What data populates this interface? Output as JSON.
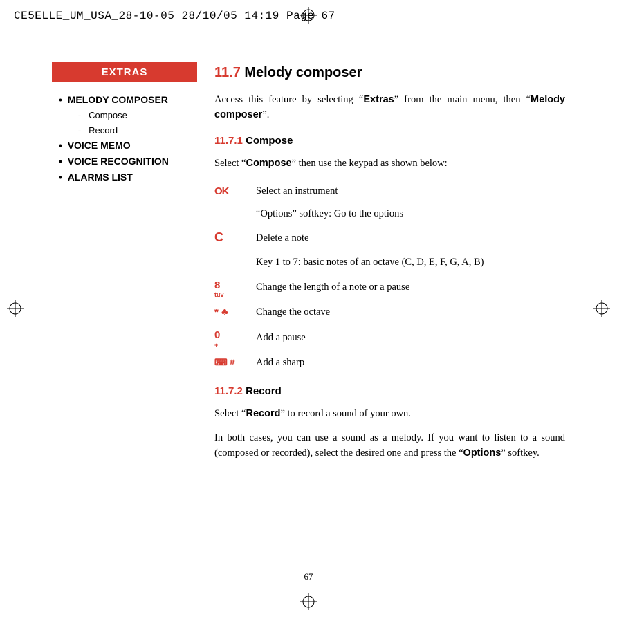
{
  "header": "CE5ELLE_UM_USA_28-10-05  28/10/05  14:19  Page 67",
  "sidebar": {
    "title": "EXTRAS",
    "items": [
      {
        "label": "MELODY COMPOSER",
        "sub": [
          "Compose",
          "Record"
        ]
      },
      {
        "label": "VOICE MEMO"
      },
      {
        "label": "VOICE RECOGNITION"
      },
      {
        "label": "ALARMS LIST"
      }
    ]
  },
  "section": {
    "num": "11.7",
    "title": "Melody composer",
    "intro_pre": "Access this feature by selecting “",
    "intro_b1": "Extras",
    "intro_mid": "” from the main menu, then “",
    "intro_b2": "Melody composer",
    "intro_post": "”."
  },
  "sub1": {
    "num": "11.7.1",
    "title": "Compose",
    "lead_pre": "Select “",
    "lead_b": "Compose",
    "lead_post": "” then use the keypad as shown below:",
    "keys": [
      {
        "icon": "OK",
        "desc": "Select an instrument"
      },
      {
        "icon": "",
        "desc_pre": "“",
        "desc_b": "Options",
        "desc_post": "” softkey: Go to the options"
      },
      {
        "icon": "C",
        "desc": "Delete a note"
      },
      {
        "icon": "",
        "desc": "Key 1 to 7: basic notes of an octave (C, D, E, F, G, A, B)"
      },
      {
        "icon": "8",
        "sub": "tuv",
        "desc": "Change the length of a note or a pause"
      },
      {
        "icon": "* ♣",
        "desc": "Change the octave"
      },
      {
        "icon": "0",
        "sub": "+",
        "desc": "Add a pause"
      },
      {
        "icon": "⌨ #",
        "desc": "Add a sharp"
      }
    ]
  },
  "sub2": {
    "num": "11.7.2",
    "title": "Record",
    "lead_pre": "Select “",
    "lead_b": "Record",
    "lead_post": "” to record a sound of your own.",
    "para2_pre": "In both cases, you can use a sound as a melody. If you want to listen to a sound (composed or recorded), select the desired one and press the “",
    "para2_b": "Options",
    "para2_post": "” softkey."
  },
  "page_number": "67"
}
